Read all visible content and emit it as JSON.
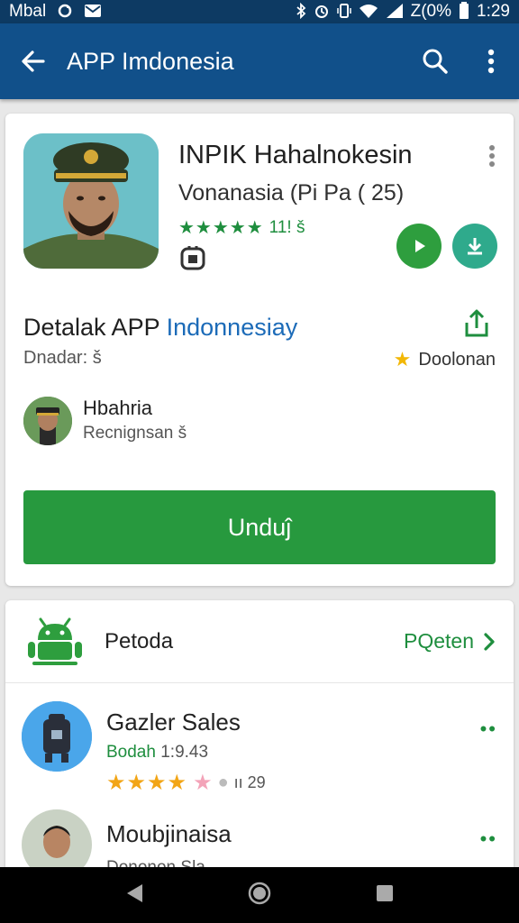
{
  "status_bar": {
    "carrier": "Mbal",
    "battery": "Z(0%",
    "time": "1:29"
  },
  "app_bar": {
    "title": "APP Imdonesia"
  },
  "app": {
    "name": "INPIK Hahalnokesin",
    "subtitle": "Vonanasia (Pi Pa ( 25)",
    "stars": "★★★★★",
    "rating_text": "11! š",
    "colors": {
      "green": "#27993e",
      "teal": "#2faa8c",
      "blue": "#1c6bb8"
    }
  },
  "detail": {
    "title_part1": "Detalak APP ",
    "title_part2": "Indonnesiay",
    "dev_label": "Dnadar: š",
    "right_label": "Doolonan"
  },
  "reviewer": {
    "name": "Hbahria",
    "sub": "Recnignsan š"
  },
  "download_button": "Unduĵ",
  "section": {
    "title": "Petoda",
    "more_label": "PQeten"
  },
  "list": [
    {
      "title": "Gazler Sales",
      "sub_green": "Bodah",
      "sub_rest": " 1:9.43",
      "stars": "★★★★",
      "rating_text": "ıı 29"
    },
    {
      "title": "Moubjinaisa",
      "sub_green": "",
      "sub_rest": "Dononon Sla"
    }
  ]
}
